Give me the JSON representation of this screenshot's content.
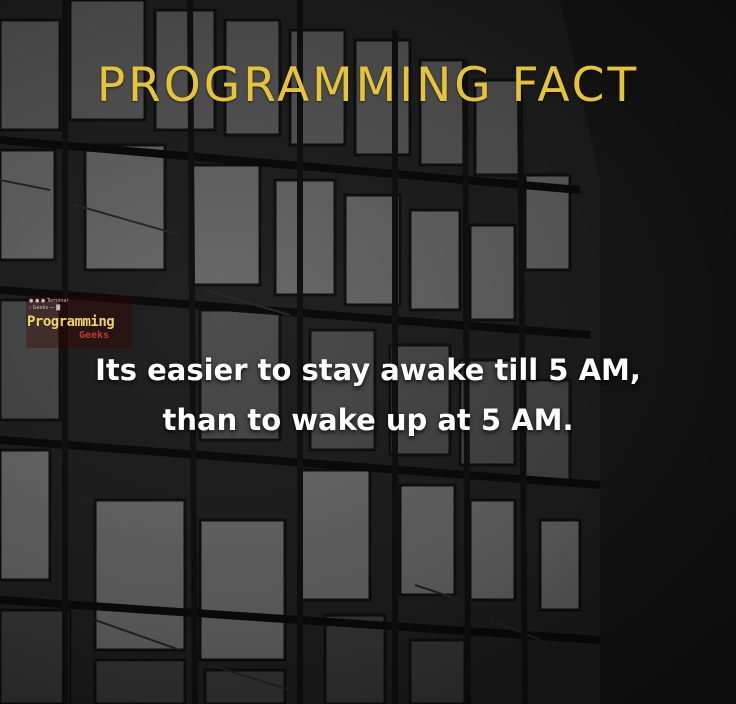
{
  "poster": {
    "title": "PROGRAMMING FACT",
    "quote_line_1": "Its easier to stay awake till 5 AM,",
    "quote_line_2": "than to wake up at 5 AM.",
    "accent_color": "#e5c43a"
  },
  "watermark": {
    "top_text": "● ● ●  Terminal",
    "sub_text": "› Geeks — █",
    "name": "Programming",
    "name_suffix": "Geeks"
  }
}
